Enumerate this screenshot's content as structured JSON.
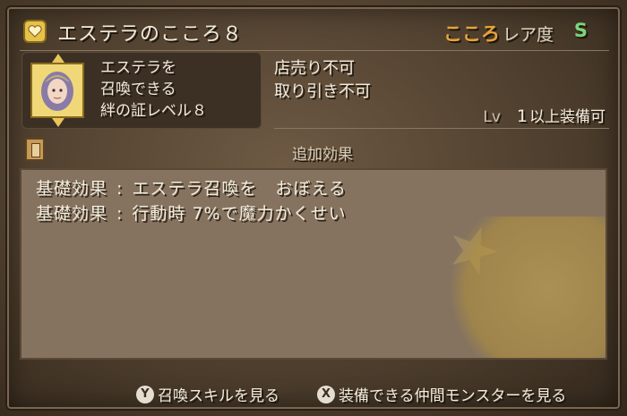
{
  "header": {
    "item_name": "エステラのこころ８",
    "kokoro_label": "こころ",
    "rarity_label": "レア度",
    "rarity_value": "S"
  },
  "portrait_card": {
    "lines": [
      "エステラを",
      "召喚できる",
      "絆の証レベル８"
    ]
  },
  "restrictions": {
    "sell": "店売り不可",
    "trade": "取り引き不可"
  },
  "level": {
    "label": "Lv",
    "value": "1",
    "suffix": "以上装備可"
  },
  "effects": {
    "header": "追加効果",
    "items": [
      {
        "label": "基礎効果",
        "text": "エステラ召喚を　おぼえる"
      },
      {
        "label": "基礎効果",
        "text": "行動時 7%で魔力かくせい"
      }
    ]
  },
  "footer": {
    "hint1": {
      "button": "Y",
      "label": "召喚スキルを見る"
    },
    "hint2": {
      "button": "X",
      "label": "装備できる仲間モンスターを見る"
    }
  },
  "colors": {
    "kokoro": "#e8a436",
    "rarity_s": "#7cd47a",
    "panel": "#857360"
  },
  "icons": [
    "heart-icon",
    "book-icon",
    "y-button-icon",
    "x-button-icon"
  ]
}
